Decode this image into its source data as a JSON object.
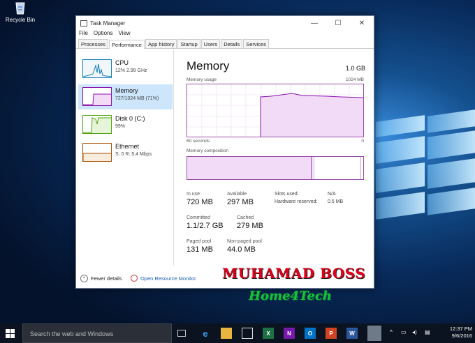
{
  "desktop": {
    "recycle_label": "Recycle Bin"
  },
  "window": {
    "title": "Task Manager",
    "controls": {
      "minimize": "—",
      "maximize": "☐",
      "close": "✕"
    }
  },
  "menu": [
    "File",
    "Options",
    "View"
  ],
  "tabs": [
    "Processes",
    "Performance",
    "App history",
    "Startup",
    "Users",
    "Details",
    "Services"
  ],
  "active_tab": "Performance",
  "resources": [
    {
      "name": "CPU",
      "sub": "12% 2.99 GHz",
      "color": "#117dbb"
    },
    {
      "name": "Memory",
      "sub": "727/1024 MB (71%)",
      "color": "#8b12ae"
    },
    {
      "name": "Disk 0 (C:)",
      "sub": "99%",
      "color": "#4da60c"
    },
    {
      "name": "Ethernet",
      "sub": "S: 0 R: 5.4 Mbps",
      "color": "#a74f01"
    }
  ],
  "memory": {
    "heading": "Memory",
    "total": "1.0 GB",
    "usage_label": "Memory usage",
    "usage_max": "1024 MB",
    "time_left": "60 seconds",
    "time_right": "0",
    "composition_label": "Memory composition",
    "usage_fraction": 0.71,
    "stats": {
      "in_use_label": "In use",
      "in_use": "720 MB",
      "available_label": "Available",
      "available": "297 MB",
      "committed_label": "Committed",
      "committed": "1.1/2.7 GB",
      "cached_label": "Cached",
      "cached": "279 MB",
      "paged_label": "Paged pool",
      "paged": "131 MB",
      "nonpaged_label": "Non-paged pool",
      "nonpaged": "44.0 MB",
      "slots_label": "Slots used:",
      "slots": "N/A",
      "hwres_label": "Hardware reserved:",
      "hwres": "0.5 MB"
    }
  },
  "footer": {
    "fewer": "Fewer details",
    "monitor": "Open Resource Monitor"
  },
  "watermark": {
    "line1": "MUHAMAD BOSS",
    "line2": "Home4Tech"
  },
  "taskbar": {
    "search_placeholder": "Search the web and Windows",
    "time": "12:37 PM",
    "date": "9/6/2016"
  }
}
